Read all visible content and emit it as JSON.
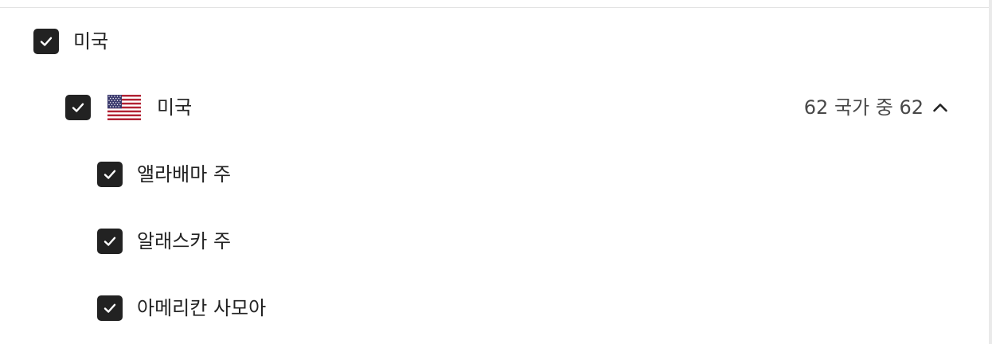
{
  "region": {
    "label": "미국",
    "checked": true
  },
  "country": {
    "label": "미국",
    "flag_icon": "us-flag-icon",
    "count_text": "62 국가 중 62",
    "checked": true,
    "expanded": true
  },
  "states": [
    {
      "label": "앨라배마 주",
      "checked": true
    },
    {
      "label": "알래스카 주",
      "checked": true
    },
    {
      "label": "아메리칸 사모아",
      "checked": true
    }
  ],
  "colors": {
    "checkbox_fill": "#222222",
    "checkmark": "#ffffff",
    "text": "#222222",
    "muted_text": "#484848"
  }
}
